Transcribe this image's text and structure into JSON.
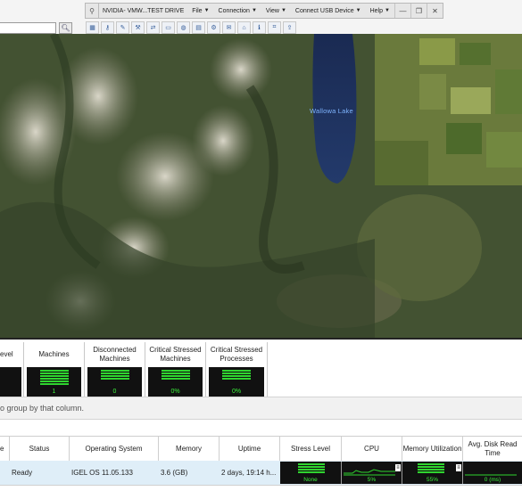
{
  "vm_toolbar": {
    "title": "NVIDIA- VMW...TEST DRIVE",
    "menus": [
      "File",
      "Connection",
      "View",
      "Connect USB Device",
      "Help"
    ]
  },
  "map": {
    "lake_label": "Wallowa Lake"
  },
  "stats": [
    {
      "label": "evel",
      "value": "",
      "bars": 0
    },
    {
      "label": "Machines",
      "value": "1",
      "bars": 6
    },
    {
      "label": "Disconnected Machines",
      "value": "0",
      "bars": 4
    },
    {
      "label": "Critical Stressed Machines",
      "value": "0%",
      "bars": 4
    },
    {
      "label": "Critical Stressed Processes",
      "value": "0%",
      "bars": 4
    }
  ],
  "group_bar": {
    "hint": "o group by that column."
  },
  "table": {
    "columns": [
      "e",
      "Status",
      "Operating System",
      "Memory",
      "Uptime",
      "Stress Level",
      "CPU",
      "Memory Utilization",
      "Avg. Disk Read Time"
    ],
    "row": {
      "status": "Ready",
      "os": "IGEL OS 11.05.133",
      "memory": "3.6 (GB)",
      "uptime": "2 days, 19:14 h...",
      "stress_level": "None",
      "cpu": "5%",
      "memory_utilization": "55%",
      "disk_read_time": "0 (ms)"
    }
  },
  "colors": {
    "meter_green": "#2fd52f",
    "meter_bg": "#111111",
    "row_selected": "#dfeef8"
  }
}
